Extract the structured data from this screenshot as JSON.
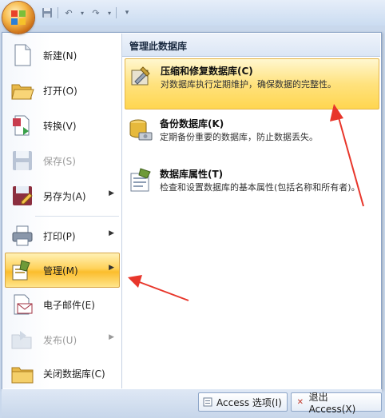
{
  "quick_access": {
    "save_icon": "save-icon",
    "undo_icon": "undo-icon",
    "redo_icon": "redo-icon",
    "customize_icon": "customize-dropdown-icon"
  },
  "menu_left": [
    {
      "label": "新建(N)",
      "icon": "new-document-icon",
      "enabled": true,
      "submenu": false
    },
    {
      "label": "打开(O)",
      "icon": "open-folder-icon",
      "enabled": true,
      "submenu": false
    },
    {
      "label": "转换(V)",
      "icon": "convert-icon",
      "enabled": true,
      "submenu": false
    },
    {
      "label": "保存(S)",
      "icon": "save-icon",
      "enabled": false,
      "submenu": false
    },
    {
      "label": "另存为(A)",
      "icon": "save-as-icon",
      "enabled": true,
      "submenu": true
    },
    {
      "label": "打印(P)",
      "icon": "printer-icon",
      "enabled": true,
      "submenu": true
    },
    {
      "label": "管理(M)",
      "icon": "manage-icon",
      "enabled": true,
      "submenu": true,
      "active": true
    },
    {
      "label": "电子邮件(E)",
      "icon": "email-icon",
      "enabled": true,
      "submenu": false
    },
    {
      "label": "发布(U)",
      "icon": "publish-icon",
      "enabled": false,
      "submenu": true
    },
    {
      "label": "关闭数据库(C)",
      "icon": "close-database-icon",
      "enabled": true,
      "submenu": false
    }
  ],
  "submenu": {
    "header": "管理此数据库",
    "items": [
      {
        "title": "压缩和修复数据库(C)",
        "desc": "对数据库执行定期维护，确保数据的完整性。",
        "icon": "compact-repair-icon",
        "highlight": true
      },
      {
        "title": "备份数据库(K)",
        "desc": "定期备份重要的数据库，防止数据丢失。",
        "icon": "backup-database-icon",
        "highlight": false
      },
      {
        "title": "数据库属性(T)",
        "desc": "检查和设置数据库的基本属性(包括名称和所有者)。",
        "icon": "database-properties-icon",
        "highlight": false
      }
    ]
  },
  "bottom": {
    "options_label": "Access 选项(I)",
    "exit_label": "退出 Access(X)"
  },
  "colors": {
    "highlight": "#ffd25a",
    "annotation": "#e8362b"
  }
}
